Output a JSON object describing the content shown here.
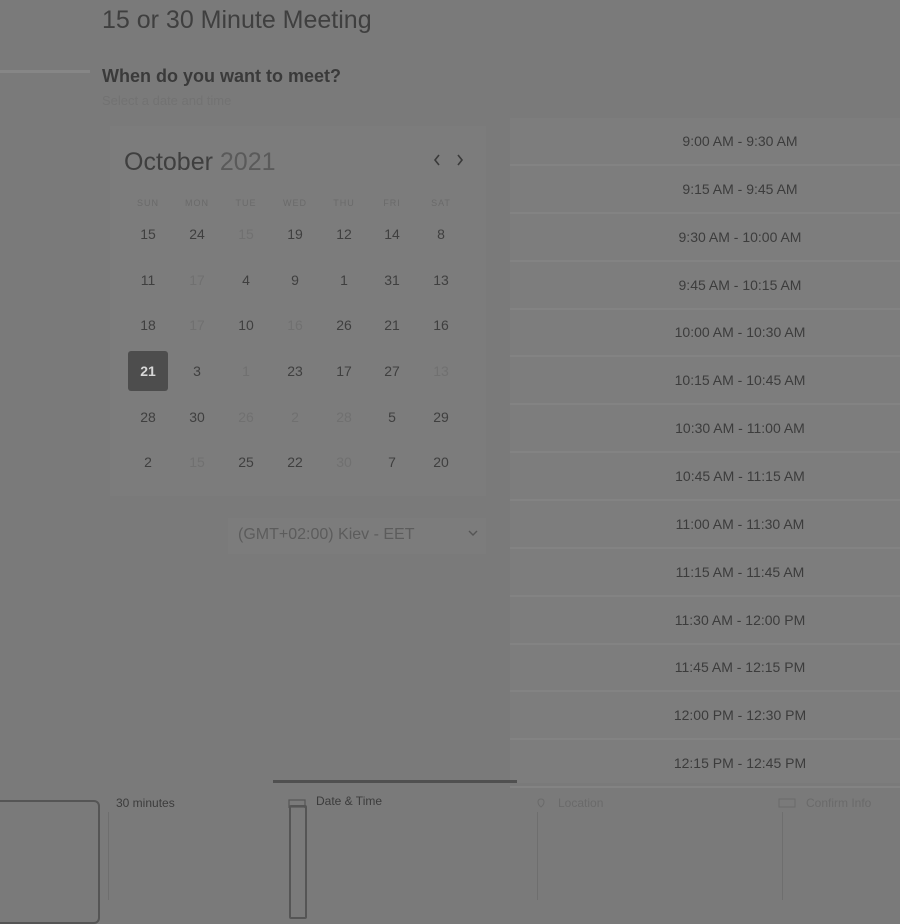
{
  "page": {
    "title": "15 or 30 Minute Meeting",
    "subtitle": "When do you want to meet?",
    "hint": "Select a date and time"
  },
  "calendar": {
    "month": "October",
    "year": "2021",
    "weekdays": [
      "SUN",
      "MON",
      "TUE",
      "WED",
      "THU",
      "FRI",
      "SAT"
    ],
    "weeks": [
      [
        "15",
        "24",
        "15",
        "19",
        "12",
        "14",
        "8"
      ],
      [
        "11",
        "17",
        "4",
        "9",
        "1",
        "31",
        "13"
      ],
      [
        "18",
        "17",
        "10",
        "16",
        "26",
        "21",
        "16"
      ],
      [
        "21",
        "3",
        "1",
        "23",
        "17",
        "27",
        "13"
      ],
      [
        "28",
        "30",
        "26",
        "2",
        "28",
        "5",
        "29"
      ],
      [
        "2",
        "15",
        "25",
        "22",
        "30",
        "7",
        "20"
      ]
    ],
    "dimmed": [
      [
        0,
        2
      ],
      [
        1,
        1
      ],
      [
        2,
        1
      ],
      [
        2,
        3
      ],
      [
        3,
        2
      ],
      [
        3,
        6
      ],
      [
        4,
        2
      ],
      [
        4,
        3
      ],
      [
        4,
        4
      ],
      [
        5,
        1
      ],
      [
        5,
        4
      ]
    ],
    "selected": [
      3,
      0
    ]
  },
  "timezone": {
    "label": "(GMT+02:00) Kiev - EET"
  },
  "slots": [
    "9:00 AM - 9:30 AM",
    "9:15 AM - 9:45 AM",
    "9:30 AM - 10:00 AM",
    "9:45 AM - 10:15 AM",
    "10:00 AM - 10:30 AM",
    "10:15 AM - 10:45 AM",
    "10:30 AM - 11:00 AM",
    "10:45 AM - 11:15 AM",
    "11:00 AM - 11:30 AM",
    "11:15 AM - 11:45 AM",
    "11:30 AM - 12:00 PM",
    "11:45 AM - 12:15 PM",
    "12:00 PM - 12:30 PM",
    "12:15 PM - 12:45 PM"
  ],
  "steps": {
    "duration": "30 minutes",
    "datetime": "Date & Time",
    "location": "Location",
    "confirm": "Confirm Info"
  },
  "colors": {
    "selected_bg": "#4d4d4d",
    "overlay": "#7a7a7a"
  }
}
